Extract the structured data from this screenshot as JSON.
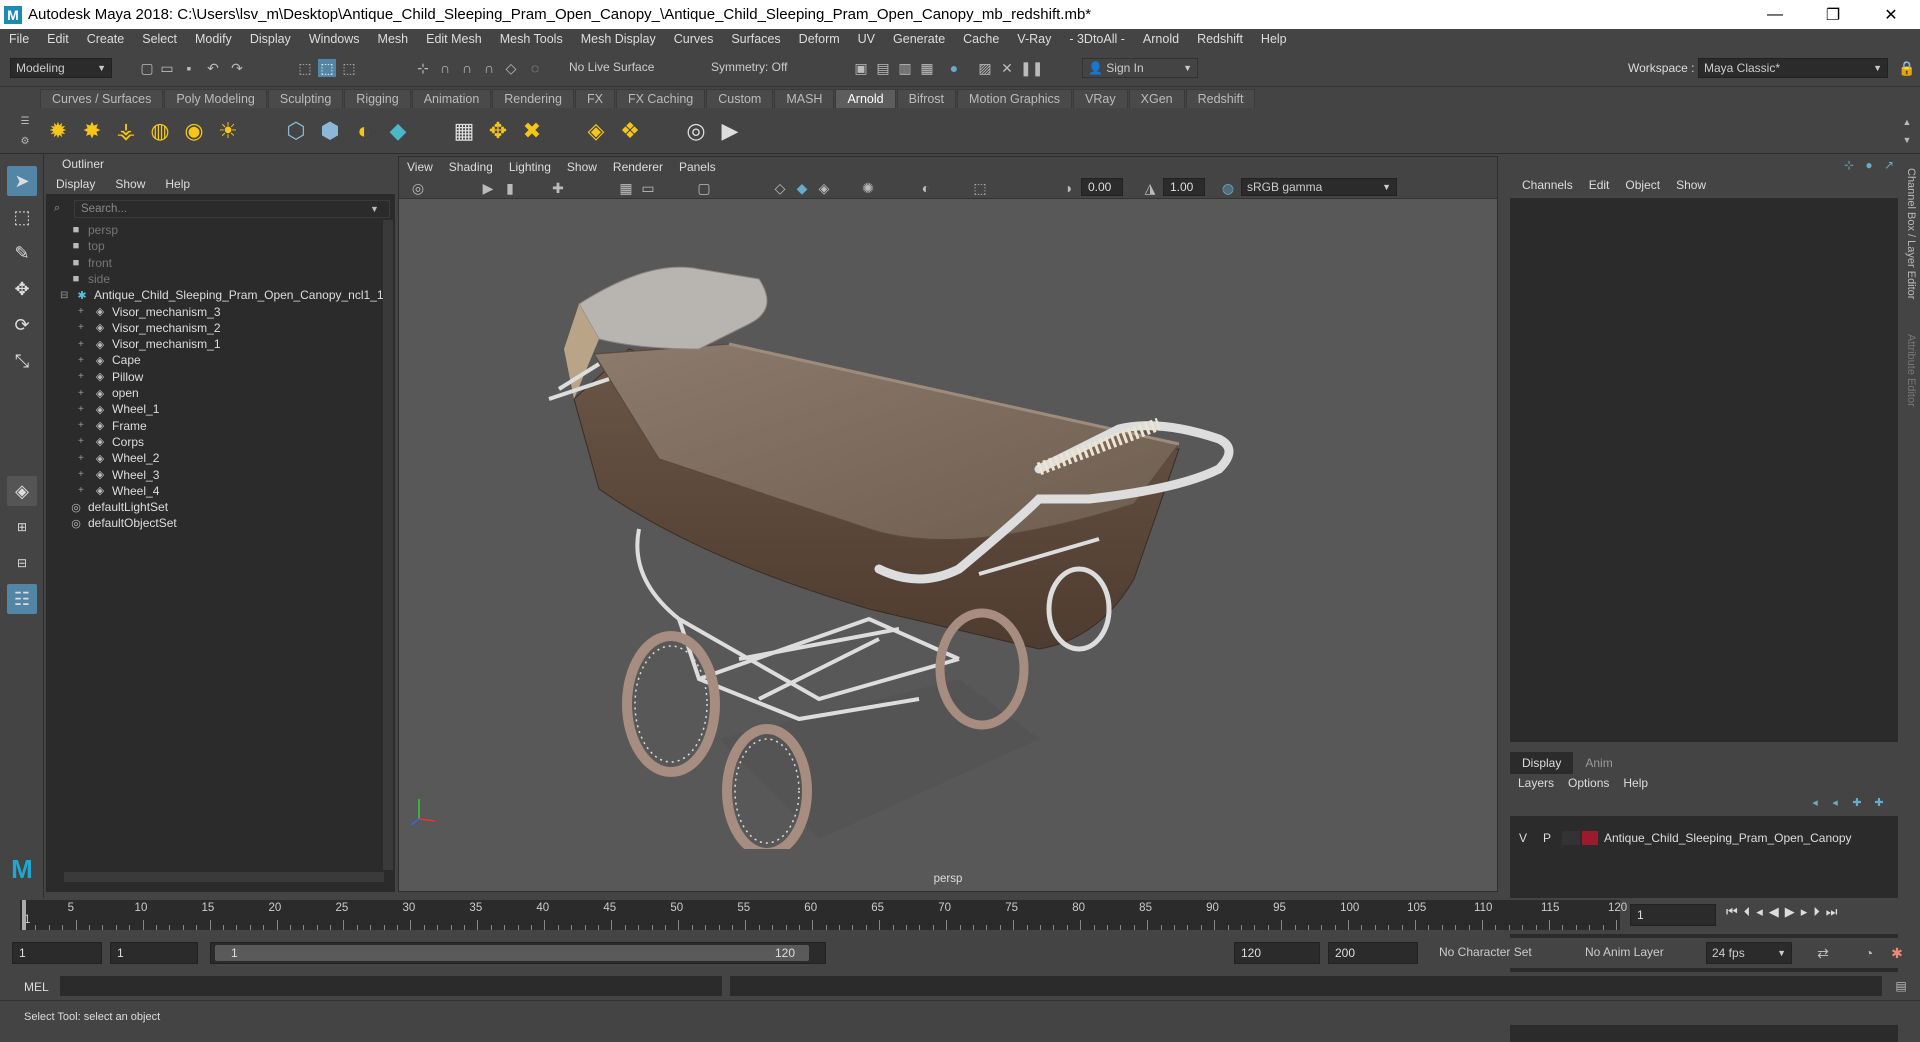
{
  "window": {
    "title": "Autodesk Maya 2018: C:\\Users\\lsv_m\\Desktop\\Antique_Child_Sleeping_Pram_Open_Canopy_\\Antique_Child_Sleeping_Pram_Open_Canopy_mb_redshift.mb*",
    "logo": "M",
    "minimize": "—",
    "restore": "❐",
    "close": "✕"
  },
  "menubar": [
    "File",
    "Edit",
    "Create",
    "Select",
    "Modify",
    "Display",
    "Windows",
    "Mesh",
    "Edit Mesh",
    "Mesh Tools",
    "Mesh Display",
    "Curves",
    "Surfaces",
    "Deform",
    "UV",
    "Generate",
    "Cache",
    "V-Ray",
    "- 3DtoAll -",
    "Arnold",
    "Redshift",
    "Help"
  ],
  "statusline": {
    "mode": "Modeling",
    "live_surface": "No Live Surface",
    "symmetry": "Symmetry: Off",
    "sign_in": "Sign In",
    "workspace_label": "Workspace :",
    "workspace": "Maya Classic*"
  },
  "shelf_tabs": [
    "Curves / Surfaces",
    "Poly Modeling",
    "Sculpting",
    "Rigging",
    "Animation",
    "Rendering",
    "FX",
    "FX Caching",
    "Custom",
    "MASH",
    "Arnold",
    "Bifrost",
    "Motion Graphics",
    "VRay",
    "XGen",
    "Redshift"
  ],
  "active_shelf": "Arnold",
  "outliner": {
    "title": "Outliner",
    "menu": [
      "Display",
      "Show",
      "Help"
    ],
    "search_placeholder": "Search...",
    "items": [
      {
        "label": "persp",
        "type": "camera",
        "dim": true,
        "indent": 1
      },
      {
        "label": "top",
        "type": "camera",
        "dim": true,
        "indent": 1
      },
      {
        "label": "front",
        "type": "camera",
        "dim": true,
        "indent": 1
      },
      {
        "label": "side",
        "type": "camera",
        "dim": true,
        "indent": 1
      },
      {
        "label": "Antique_Child_Sleeping_Pram_Open_Canopy_ncl1_1",
        "type": "group",
        "dim": false,
        "indent": 0
      },
      {
        "label": "Visor_mechanism_3",
        "type": "mesh",
        "dim": false,
        "indent": 2
      },
      {
        "label": "Visor_mechanism_2",
        "type": "mesh",
        "dim": false,
        "indent": 2
      },
      {
        "label": "Visor_mechanism_1",
        "type": "mesh",
        "dim": false,
        "indent": 2
      },
      {
        "label": "Cape",
        "type": "mesh",
        "dim": false,
        "indent": 2
      },
      {
        "label": "Pillow",
        "type": "mesh",
        "dim": false,
        "indent": 2
      },
      {
        "label": "open",
        "type": "mesh",
        "dim": false,
        "indent": 2
      },
      {
        "label": "Wheel_1",
        "type": "mesh",
        "dim": false,
        "indent": 2
      },
      {
        "label": "Frame",
        "type": "mesh",
        "dim": false,
        "indent": 2
      },
      {
        "label": "Corps",
        "type": "mesh",
        "dim": false,
        "indent": 2
      },
      {
        "label": "Wheel_2",
        "type": "mesh",
        "dim": false,
        "indent": 2
      },
      {
        "label": "Wheel_3",
        "type": "mesh",
        "dim": false,
        "indent": 2
      },
      {
        "label": "Wheel_4",
        "type": "mesh",
        "dim": false,
        "indent": 2
      },
      {
        "label": "defaultLightSet",
        "type": "set",
        "dim": false,
        "indent": 1
      },
      {
        "label": "defaultObjectSet",
        "type": "set",
        "dim": false,
        "indent": 1
      }
    ]
  },
  "viewport": {
    "menu": [
      "View",
      "Shading",
      "Lighting",
      "Show",
      "Renderer",
      "Panels"
    ],
    "exposure": "0.00",
    "gamma": "1.00",
    "color_space": "sRGB gamma",
    "camera_label": "persp"
  },
  "channel_box": {
    "menu": [
      "Channels",
      "Edit",
      "Object",
      "Show"
    ],
    "side_label": "Channel Box / Layer Editor",
    "side_label2": "Attribute Editor"
  },
  "layer_editor": {
    "tabs": [
      "Display",
      "Anim"
    ],
    "menu": [
      "Layers",
      "Options",
      "Help"
    ],
    "layer": {
      "v": "V",
      "p": "P",
      "name": "Antique_Child_Sleeping_Pram_Open_Canopy",
      "color": "#9b1b2c"
    }
  },
  "timeline": {
    "ticks": [
      "1",
      "5",
      "10",
      "15",
      "20",
      "25",
      "30",
      "35",
      "40",
      "45",
      "50",
      "55",
      "60",
      "65",
      "70",
      "75",
      "80",
      "85",
      "90",
      "95",
      "100",
      "105",
      "110",
      "115",
      "120"
    ],
    "current_frame": "1"
  },
  "range": {
    "start": "1",
    "playback_start": "1",
    "slider_start": "1",
    "slider_end": "120",
    "playback_end": "120",
    "end": "200",
    "character_set": "No Character Set",
    "anim_layer": "No Anim Layer",
    "fps": "24 fps"
  },
  "mel": {
    "label": "MEL"
  },
  "help_line": "Select Tool: select an object",
  "colors": {
    "accent": "#5285a6",
    "layer_red": "#9b1b2c",
    "bg": "#444444",
    "panel": "#2b2b2b"
  }
}
